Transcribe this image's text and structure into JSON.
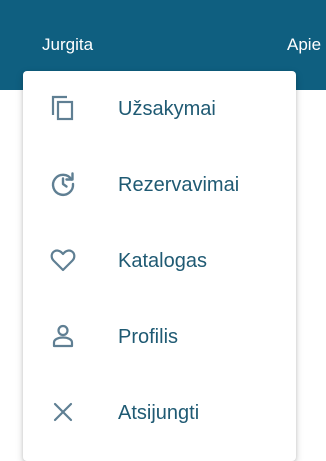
{
  "header": {
    "user_name": "Jurgita",
    "about_label": "Apie",
    "background_color": "#0f5f80"
  },
  "menu": {
    "label_color": "#1f5a73",
    "icon_color": "#5f7f93",
    "items": [
      {
        "label": "Užsakymai",
        "icon": "copy-icon"
      },
      {
        "label": "Rezervavimai",
        "icon": "history-icon"
      },
      {
        "label": "Katalogas",
        "icon": "heart-icon"
      },
      {
        "label": "Profilis",
        "icon": "person-icon"
      },
      {
        "label": "Atsijungti",
        "icon": "close-icon"
      }
    ]
  }
}
